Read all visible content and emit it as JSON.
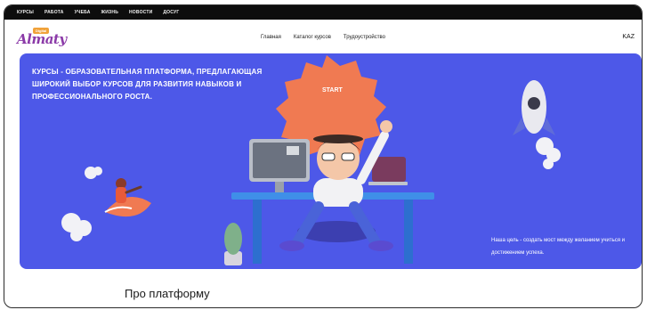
{
  "topbar": {
    "links": [
      "КУРСЫ",
      "РАБОТА",
      "УЧЕБА",
      "ЖИЗНЬ",
      "НОВОСТИ",
      "ДОСУГ"
    ]
  },
  "header": {
    "logo_text": "Almaty",
    "logo_badge": "Digital",
    "nav": [
      "Главная",
      "Каталог курсов",
      "Трудоустройство"
    ],
    "lang": "KAZ"
  },
  "hero": {
    "title": "Курсы - образовательная платформа, предлагающая широкий выбор курсов для развития навыков и профессионального роста.",
    "start_label": "START",
    "note": "Наша цель - создать мост между желанием учиться и достижением успеха.",
    "colors": {
      "background": "#4d58e8",
      "burst": "#f07a52"
    }
  },
  "section": {
    "title": "Про платформу"
  }
}
